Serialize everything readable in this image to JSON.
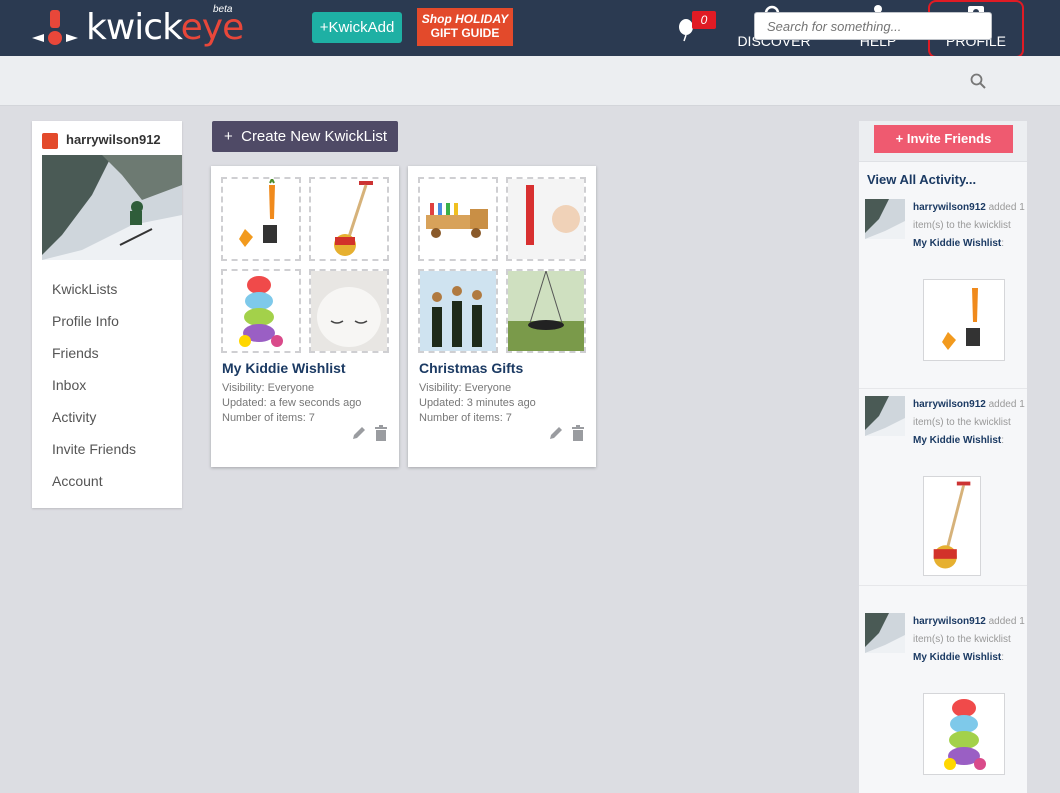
{
  "header": {
    "logo": {
      "prefix": "kwick",
      "suffix": "eye",
      "badge": "beta"
    },
    "kwickadd_label": "+KwickAdd",
    "holiday": {
      "line1": "Shop HOLIDAY",
      "line2": "GIFT GUIDE"
    },
    "notifications_count": "0",
    "nav": {
      "discover": "DISCOVER",
      "help": "HELP",
      "profile": "PROFILE"
    }
  },
  "search": {
    "placeholder": "Search for something..."
  },
  "sidebar": {
    "username": "harrywilson912",
    "menu": [
      "KwickLists",
      "Profile Info",
      "Friends",
      "Inbox",
      "Activity",
      "Invite Friends",
      "Account"
    ]
  },
  "main": {
    "create_label": "Create New KwickList",
    "create_plus": "+",
    "lists": [
      {
        "title": "My Kiddie Wishlist",
        "visibility": "Visibility: Everyone",
        "updated": "Updated: a few seconds ago",
        "items": "Number of items: 7"
      },
      {
        "title": "Christmas Gifts",
        "visibility": "Visibility: Everyone",
        "updated": "Updated: 3 minutes ago",
        "items": "Number of items: 7"
      }
    ]
  },
  "rightbar": {
    "invite_label": "+ Invite Friends",
    "activity_head": "View All Activity...",
    "activities": [
      {
        "user": "harrywilson912",
        "added": "added",
        "middle": "1 item(s) to the kwicklist",
        "list": "My Kiddie Wishlist",
        "tail": ":"
      },
      {
        "user": "harrywilson912",
        "added": "added",
        "middle": "1 item(s) to the kwicklist",
        "list": "My Kiddie Wishlist",
        "tail": ":"
      },
      {
        "user": "harrywilson912",
        "added": "added",
        "middle": "1 item(s) to the kwicklist",
        "list": "My Kiddie Wishlist",
        "tail": ":"
      }
    ]
  },
  "colors": {
    "topbar": "#2b3a51",
    "accent_red": "#e34a2b",
    "teal": "#1eb0a4",
    "pink": "#ef5a70",
    "navy_text": "#1b3a63"
  }
}
